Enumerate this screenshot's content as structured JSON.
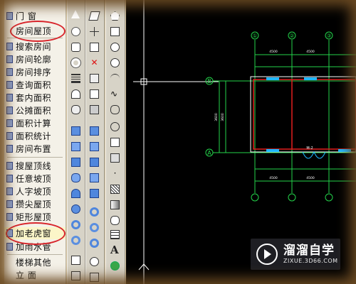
{
  "menu": {
    "items": [
      {
        "label": "门    窗"
      },
      {
        "label": "房间屋顶"
      },
      {
        "label": "搜索房间"
      },
      {
        "label": "房间轮廓"
      },
      {
        "label": "房间排序"
      },
      {
        "label": "查询面积"
      },
      {
        "label": "套内面积"
      },
      {
        "label": "公摊面积"
      },
      {
        "label": "面积计算"
      },
      {
        "label": "面积统计"
      },
      {
        "label": "房间布置"
      },
      {
        "label": "搜屋顶线"
      },
      {
        "label": "任意坡顶"
      },
      {
        "label": "人字坡顶"
      },
      {
        "label": "攒尖屋顶"
      },
      {
        "label": "矩形屋顶"
      },
      {
        "label": "加老虎窗"
      },
      {
        "label": "加雨水管"
      },
      {
        "label": "楼梯其他"
      },
      {
        "label": "立    面"
      }
    ]
  },
  "drawing": {
    "axis_labels_top": [
      "①",
      "②",
      "③"
    ],
    "axis_label_b": "B",
    "axis_label_a": "A",
    "window_label": "M-2",
    "dims_top": [
      "4500",
      "4500"
    ],
    "dims_bottom": [
      "4500",
      "4500"
    ],
    "dims_left": [
      "3600",
      "3600"
    ]
  },
  "watermark": {
    "title": "溜溜自学",
    "subtitle": "ZIXUE.3D66.COM"
  },
  "colors": {
    "canvas": "#000000",
    "grid_lines": "#23d34a",
    "walls": "#e21d1d",
    "windows": "#1fb7ff",
    "annotation_ring": "#d8262c"
  }
}
